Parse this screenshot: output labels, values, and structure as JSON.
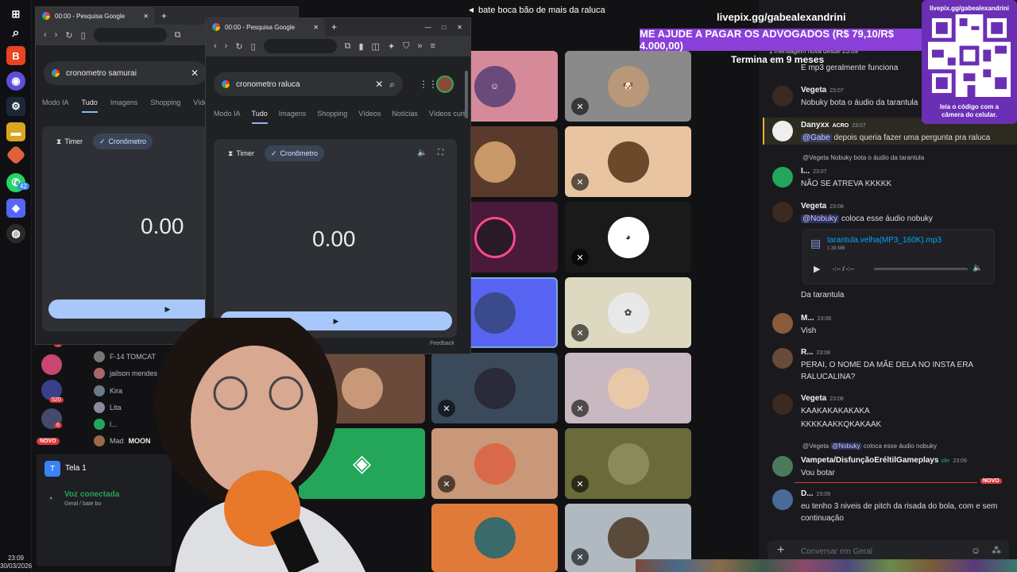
{
  "taskbar": {
    "clock_time": "23:09",
    "clock_date": "30/03/2026",
    "badge_whatsapp": "42"
  },
  "discord": {
    "channel_title": "bate boca bão de mais da raluca",
    "screen_label": "Tela 1",
    "voice_status": "Voz conectada",
    "voice_sub": "Geral / bate bo",
    "new_badge": "NOVO",
    "server_badges": [
      "4",
      "520",
      "6"
    ],
    "members": [
      "F-14 TOMCAT",
      "jailson mendes",
      "Kira",
      "Lita",
      "l...",
      "Mad"
    ],
    "moon_tag": "MOON"
  },
  "browser_back": {
    "tab_title": "00:00 - Pesquisa Google",
    "search": "cronometro samurai",
    "tabs": [
      "Modo IA",
      "Tudo",
      "Imagens",
      "Shopping",
      "Vídeos"
    ],
    "chip_timer": "Timer",
    "chip_stopwatch": "Cronômetro",
    "time": "0.00"
  },
  "browser_front": {
    "tab_title": "00:00 - Pesquisa Google",
    "search": "cronometro raluca",
    "tabs": [
      "Modo IA",
      "Tudo",
      "Imagens",
      "Shopping",
      "Vídeos",
      "Notícias",
      "Vídeos curt"
    ],
    "chip_timer": "Timer",
    "chip_stopwatch": "Cronômetro",
    "time": "0.00",
    "feedback": "Feedback"
  },
  "overlay": {
    "livepix": "livepix.gg/gabealexandrini",
    "banner": "ME AJUDE A PAGAR OS ADVOGADOS (R$ 79,10/R$ 4.000,00)",
    "termina": "Termina em 9 meses",
    "qr_title": "livepix.gg/gabealexandrini",
    "qr_caption": "leia o código com a câmera do celular."
  },
  "chat": {
    "new_since": "1 mensagem nova desde 23:09",
    "m0_text": "E mp3 geralmente funciona",
    "m1_user": "Vegeta",
    "m1_time": "23:07",
    "m1_text": "Nobuky bota o áudio da tarantula",
    "m2_user": "Danyxx",
    "m2_tag": "ACRO",
    "m2_time": "23:07",
    "m2_mention": "@Gabe",
    "m2_text": " depois queria fazer uma pergunta pra raluca",
    "m3_reply_user": "@Vegeta",
    "m3_reply_text": "Nobuky bota o áudio da tarantula",
    "m3_user": "I...",
    "m3_time": "23:07",
    "m3_text": "NÃO SE ATREVA KKKKK",
    "m4_user": "Vegeta",
    "m4_time": "23:08",
    "m4_mention": "@Nobuky",
    "m4_text": " coloca esse áudio nobuky",
    "file_name": "tarantula.velha(MP3_160K).mp3",
    "file_size": "1.39 MB",
    "file_time": "-:-- / -:--",
    "m5_text": "Da tarantula",
    "m6_user": "M...",
    "m6_time": "23:08",
    "m6_text": "Vish",
    "m7_user": "R...",
    "m7_time": "23:08",
    "m7_text": "PERAI, O NOME DA MÃE DELA NO INSTA ERA RALUCALINA?",
    "m8_user": "Vegeta",
    "m8_time": "23:08",
    "m8_text1": "KAAKAKAKAKAKA",
    "m8_text2": "KKKKAAKKQKAKAAK",
    "m9_reply_user": "@Vegeta",
    "m9_reply_mention": "@Nobuky",
    "m9_reply_text": "coloca esse áudio nobuky",
    "m9_user": "Vampeta/DisfunçãoEréltilGameplays",
    "m9_tag": "idle",
    "m9_time": "23:09",
    "m9_text": "Vou botar",
    "new_label": "NOVO",
    "m10_user": "D...",
    "m10_time": "23:09",
    "m10_text": "eu tenho 3 niveis de pitch da risada do bola, com e sem continuação",
    "input_placeholder": "Conversar em Geral"
  },
  "colors": {
    "accent": "#5865f2",
    "banner": "#8b3fd9",
    "play": "#a8c7fa",
    "new_red": "#da373c"
  }
}
